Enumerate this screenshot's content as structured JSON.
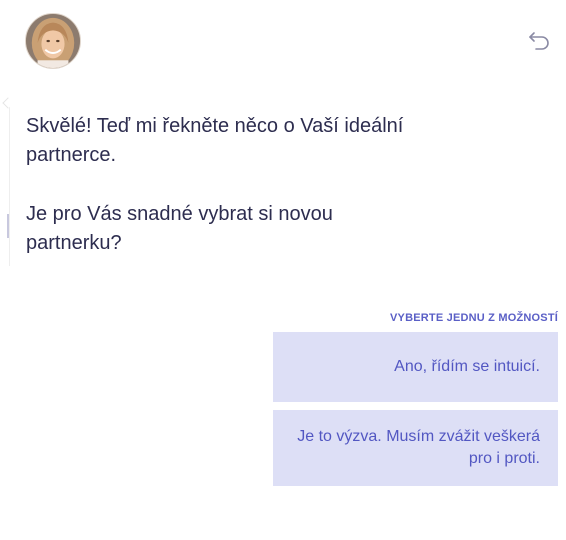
{
  "header": {
    "avatar_icon": "woman-portrait-avatar",
    "back_icon": "undo-arrow-icon"
  },
  "messages": [
    {
      "text": "Skvělé! Teď mi řekněte něco o Vaší ideální partnerce."
    },
    {
      "text": "Je pro Vás snadné vybrat si novou partnerku?"
    }
  ],
  "choices": {
    "label": "VYBERTE JEDNU Z MOŽNOSTÍ",
    "options": [
      {
        "label": "Ano, řídím se intuicí."
      },
      {
        "label": "Je to výzva. Musím zvážit veškerá pro i proti."
      }
    ]
  },
  "colors": {
    "accent": "#5257c2",
    "option_bg": "#dddff6",
    "text": "#2d2d4f"
  }
}
